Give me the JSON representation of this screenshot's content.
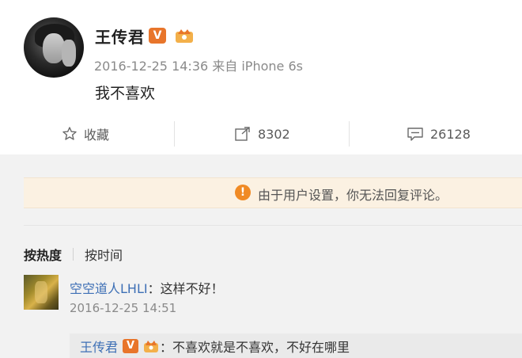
{
  "post": {
    "author": "王传君",
    "verified_badge": "V",
    "meta": "2016-12-25 14:36 来自 iPhone 6s",
    "body": "我不喜欢"
  },
  "actions": {
    "favorite_label": "收藏",
    "repost_count": "8302",
    "comment_count": "26128"
  },
  "notice": {
    "icon": "!",
    "text": "由于用户设置，你无法回复评论。"
  },
  "sort_tabs": {
    "hot": "按热度",
    "time": "按时间"
  },
  "comment": {
    "author": "空空道人LHLI",
    "separator": "：",
    "text": "这样不好！",
    "time": "2016-12-25 14:51"
  },
  "reply": {
    "author": "王传君",
    "verified_badge": "V",
    "separator": "：",
    "text": "不喜欢就是不喜欢，不好在哪里"
  },
  "colors": {
    "accent_orange": "#e8752b",
    "link_blue": "#3d6fb5",
    "notice_bg": "#fbf1e2"
  },
  "icons": [
    "star-icon",
    "repost-icon",
    "comment-icon",
    "warning-icon",
    "member-crown-icon",
    "verified-v-icon"
  ]
}
